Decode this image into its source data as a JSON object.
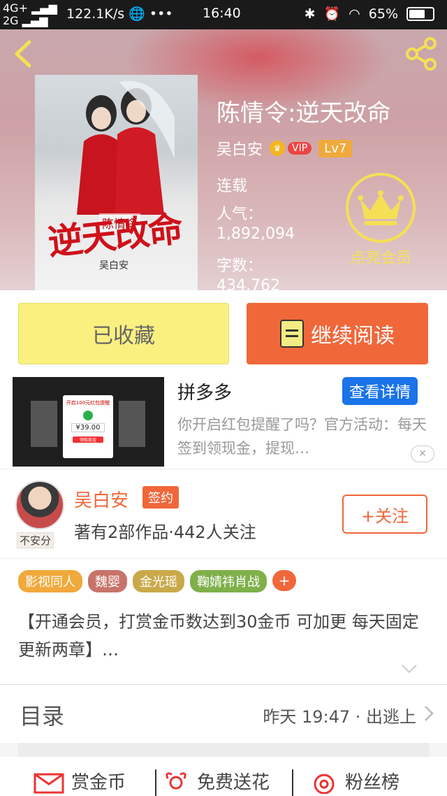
{
  "status_bar": {
    "network_1": "4G+",
    "network_2": "2G",
    "speed": "122.1K/s",
    "more": "•••",
    "time": "16:40",
    "battery": "65%"
  },
  "book": {
    "title": "陈情令:逆天改命",
    "author": "吴白安",
    "vip_label": "VIP",
    "level": "Lv7",
    "status": "连载",
    "popularity_label": "人气：",
    "popularity": "1,892,094",
    "word_count_label": "字数：",
    "word_count": "434,762",
    "cover": {
      "subtitle": "陈情令",
      "title": "逆天改命",
      "author": "吴白安"
    }
  },
  "member": {
    "label": "点亮会员"
  },
  "actions": {
    "collected_label": "已收藏",
    "continue_label": "继续阅读"
  },
  "ad": {
    "name": "拼多多",
    "detail_label": "查看详情",
    "description": "你开启红包提醒了吗？官方活动：每天签到领现金，提现…",
    "close_label": "✕",
    "card_title": "开启100元红包提醒",
    "card_price": "¥39.00",
    "card_btn": "领取现金"
  },
  "author_card": {
    "name": "吴白安",
    "signed_label": "签约",
    "meta": "著有2部作品·442人关注",
    "avatar_tag": "不安分",
    "follow_label": "+关注"
  },
  "tags": [
    {
      "label": "影视同人",
      "color": "#f0a93b"
    },
    {
      "label": "魏婴",
      "color": "#c8736a"
    },
    {
      "label": "金光瑶",
      "color": "#c9a94a"
    },
    {
      "label": "鞠婧祎肖战",
      "color": "#7fb04a"
    }
  ],
  "tag_add_label": "+",
  "intro": "【开通会员，打赏金币数达到30金币  可加更  每天固定更新两章】…",
  "toc": {
    "label": "目录",
    "latest": "昨天 19:47 · 出逃上"
  },
  "bottom_bar": {
    "reward_label": "赏金币",
    "flower_label": "免费送花",
    "fans_label": "粉丝榜"
  },
  "colors": {
    "accent": "#f0673a",
    "collect_bg": "#faf080",
    "member_gold": "#f5e055",
    "ad_blue": "#1a73e8"
  }
}
